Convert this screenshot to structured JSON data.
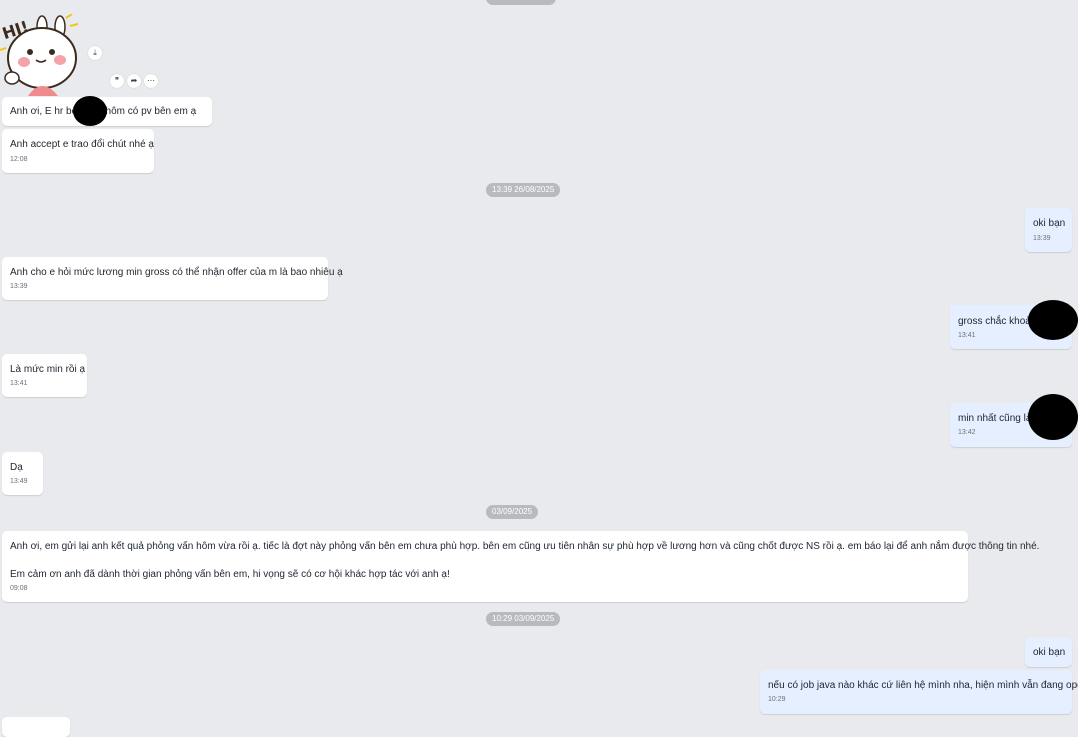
{
  "sticker": {
    "text": "HI!",
    "icon": "bunny-hi-sticker"
  },
  "sticker_actions": [
    {
      "icon": "download-icon",
      "glyph": "⤓"
    },
    {
      "icon": "quote-icon",
      "glyph": "❞"
    },
    {
      "icon": "forward-icon",
      "glyph": "➦"
    },
    {
      "icon": "more-icon",
      "glyph": "⋯"
    }
  ],
  "messages": [
    {
      "text": "Anh ơi, E hr bên          vừa hôm có pv bên em ạ",
      "time": ""
    },
    {
      "text": "Anh accept e trao đổi chút nhé ạ",
      "time": "12:08"
    },
    {
      "text": "oki bạn",
      "time": "13:39"
    },
    {
      "text": "Anh cho e hỏi mức lương min gross có thể nhận offer của m là bao nhiêu ạ",
      "time": "13:39"
    },
    {
      "text": "gross chắc khoả",
      "time": "13:41"
    },
    {
      "text": "Là mức min rồi ạ",
      "time": "13:41"
    },
    {
      "text": "min nhất cũng là",
      "time": "13:42"
    },
    {
      "text": "Dạ",
      "time": "13:49"
    },
    {
      "text": "Anh ơi, em gửi lại anh kết quả phỏng vấn hôm vừa rồi ạ. tiếc là đợt này phỏng vấn bên em chưa phù hợp. bên em cũng ưu tiên nhân sự phù hợp về lương hơn và cũng chốt được NS rồi ạ. em báo lại để anh nắm được thông tin nhé.",
      "text2": "Em cảm ơn anh đã dành thời gian phỏng vấn bên em, hi vọng sẽ có cơ hội khác hợp tác với anh ạ!",
      "time": "09:08"
    },
    {
      "text": "oki bạn",
      "time": ""
    },
    {
      "text": "nếu có job java nào khác cứ liên hệ mình nha, hiện mình vẫn đang open",
      "time": "10:29"
    }
  ],
  "dates": [
    "13:39 26/08/2025",
    "03/09/2025",
    "10:29 03/09/2025"
  ],
  "colors": {
    "background": "#e9eaed",
    "incoming": "#ffffff",
    "outgoing": "#e5efff",
    "date_pill": "#b7babf"
  }
}
